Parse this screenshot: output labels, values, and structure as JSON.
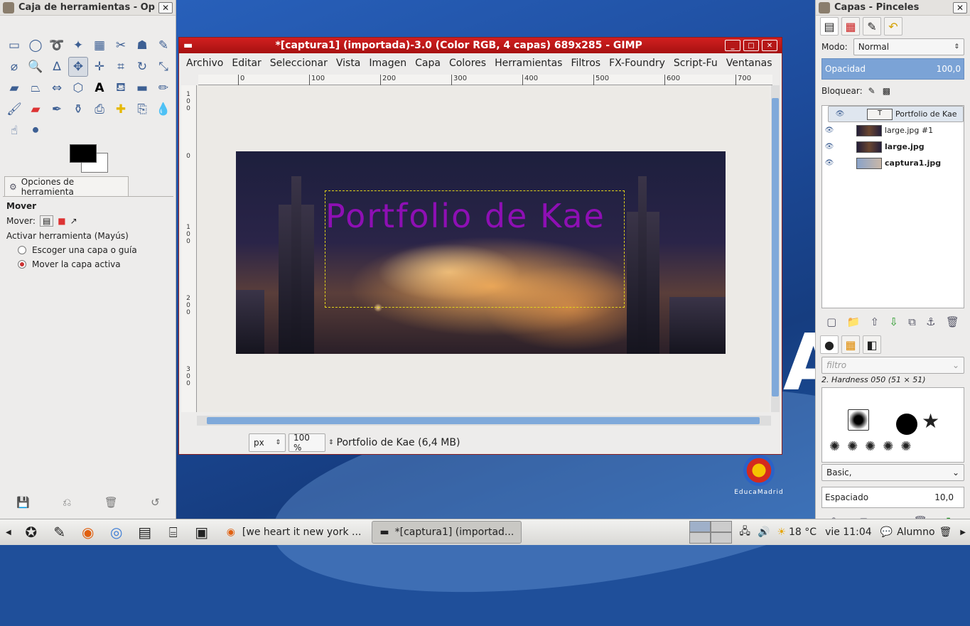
{
  "toolbox": {
    "title": "Caja de herramientas - Op",
    "options_tab": "Opciones de herramienta",
    "tool_name": "Mover",
    "move_label": "Mover:",
    "activate_label": "Activar herramienta  (Mayús)",
    "option1": "Escoger una capa o guía",
    "option2": "Mover la capa activa"
  },
  "image_window": {
    "title": "*[captura1] (importada)-3.0 (Color RGB, 4 capas) 689x285 - GIMP",
    "menu": [
      "Archivo",
      "Editar",
      "Seleccionar",
      "Vista",
      "Imagen",
      "Capa",
      "Colores",
      "Herramientas",
      "Filtros",
      "FX-Foundry",
      "Script-Fu",
      "Ventanas"
    ],
    "ruler_h": [
      "0",
      "100",
      "200",
      "300",
      "400",
      "500",
      "600",
      "700"
    ],
    "ruler_v": [
      "1\n0\n0",
      "0",
      "1\n0\n0",
      "2\n0\n0",
      "3\n0\n0"
    ],
    "canvas_text": "Portfolio de Kae",
    "unit": "px",
    "zoom": "100 %",
    "status": "Portfolio de Kae (6,4 MB)"
  },
  "dock": {
    "title": "Capas - Pinceles",
    "mode_label": "Modo:",
    "mode_value": "Normal",
    "opacity_label": "Opacidad",
    "opacity_value": "100,0",
    "lock_label": "Bloquear:",
    "layers": [
      {
        "name": "Portfolio de Kae"
      },
      {
        "name": "large.jpg #1"
      },
      {
        "name": "large.jpg"
      },
      {
        "name": "captura1.jpg"
      }
    ],
    "filter_placeholder": "filtro",
    "brush_name": "2. Hardness 050 (51 × 51)",
    "preset": "Basic,",
    "spacing_label": "Espaciado",
    "spacing_value": "10,0"
  },
  "desktop": {
    "big_letter": "A",
    "educa_logo": "EducaMadrid"
  },
  "taskbar": {
    "task1": "[we heart it new york ...",
    "task2": "*[captura1] (importad...",
    "weather": "18 °C",
    "clock": "vie 11:04",
    "user": "Alumno"
  }
}
